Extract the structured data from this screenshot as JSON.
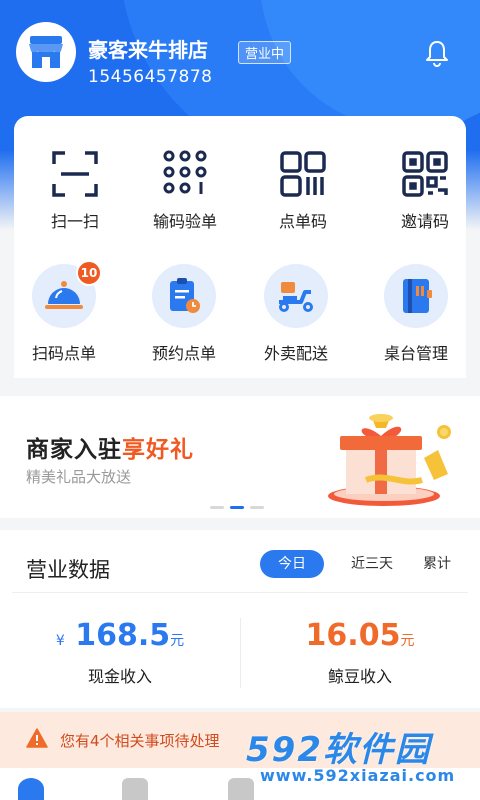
{
  "header": {
    "shop_name": "豪客来牛排店",
    "status": "营业中",
    "phone": "15456457878"
  },
  "quick_actions": [
    {
      "label": "扫一扫",
      "icon": "scan-icon"
    },
    {
      "label": "输码验单",
      "icon": "keypad-icon"
    },
    {
      "label": "点单码",
      "icon": "barcode-icon"
    },
    {
      "label": "邀请码",
      "icon": "qrcode-icon"
    }
  ],
  "services": [
    {
      "label": "扫码点单",
      "icon": "cloche-icon",
      "badge": "10"
    },
    {
      "label": "预约点单",
      "icon": "clipboard-clock-icon"
    },
    {
      "label": "外卖配送",
      "icon": "scooter-icon"
    },
    {
      "label": "桌台管理",
      "icon": "table-book-icon"
    }
  ],
  "banner": {
    "title_main": "商家入驻",
    "title_highlight": "享好礼",
    "subtitle": "精美礼品大放送"
  },
  "business_data": {
    "title": "营业数据",
    "tabs": [
      "今日",
      "近三天",
      "累计"
    ],
    "active_tab": "今日",
    "cash": {
      "symbol": "¥",
      "value": "168.5",
      "unit": "元",
      "label": "现金收入"
    },
    "beans": {
      "value": "16.05",
      "unit": "元",
      "label": "鲸豆收入"
    }
  },
  "notice": {
    "text": "您有4个相关事项待处理"
  },
  "watermark": {
    "logo": "592软件园",
    "url": "www.592xiazai.com"
  },
  "colors": {
    "primary": "#1f6ef0",
    "accent": "#f05a22",
    "notice_bg": "#fde9dd"
  }
}
